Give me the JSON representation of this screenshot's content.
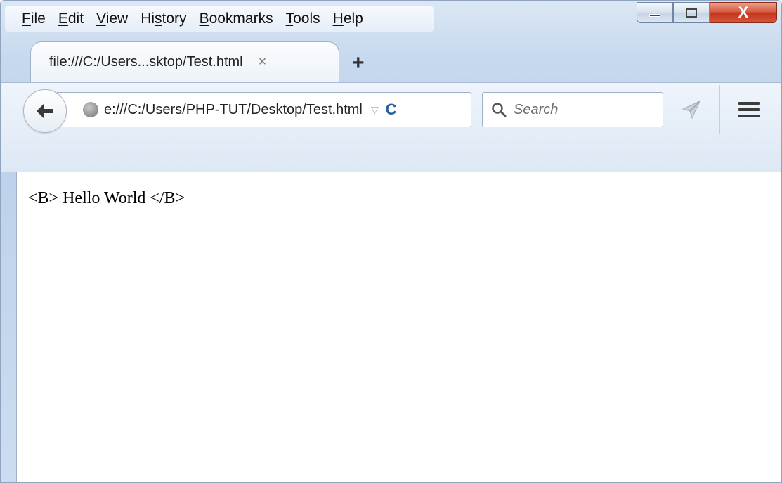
{
  "menubar": {
    "items": [
      {
        "pre": "",
        "key": "F",
        "post": "ile"
      },
      {
        "pre": "",
        "key": "E",
        "post": "dit"
      },
      {
        "pre": "",
        "key": "V",
        "post": "iew"
      },
      {
        "pre": "Hi",
        "key": "s",
        "post": "tory"
      },
      {
        "pre": "",
        "key": "B",
        "post": "ookmarks"
      },
      {
        "pre": "",
        "key": "T",
        "post": "ools"
      },
      {
        "pre": "",
        "key": "H",
        "post": "elp"
      }
    ]
  },
  "window_controls": {
    "close_label": "X"
  },
  "tab": {
    "title": "file:///C:/Users...sktop/Test.html",
    "close_glyph": "×"
  },
  "new_tab_glyph": "+",
  "navbar": {
    "url": "e:///C:/Users/PHP-TUT/Desktop/Test.html",
    "dropmark_glyph": "▽",
    "reload_glyph": "C",
    "search_placeholder": "Search"
  },
  "content": {
    "text": "<B> Hello World </B>"
  },
  "colors": {
    "accent": "#2b5f99",
    "close_button": "#c7361c"
  }
}
